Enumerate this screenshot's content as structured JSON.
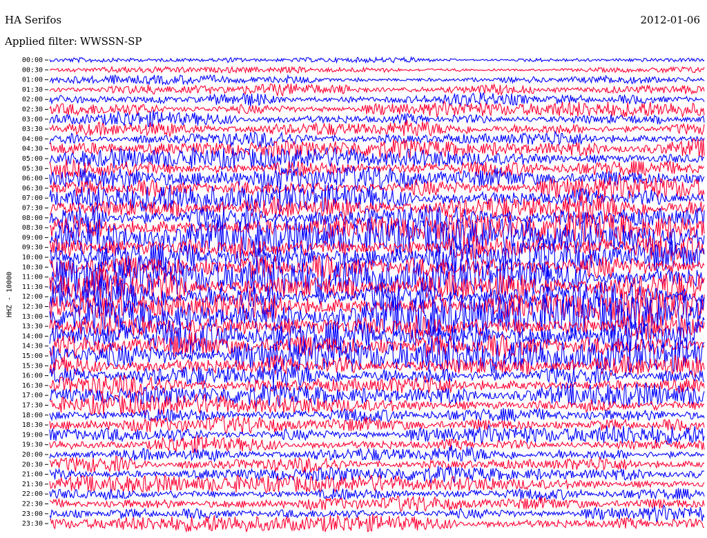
{
  "header": {
    "station": "HA Serifos",
    "date": "2012-01-06",
    "filter_label": "Applied filter:",
    "filter_value": "WWSSN-SP"
  },
  "chart_data": {
    "type": "line",
    "title": "HA Serifos",
    "ylabel": "HHZ - 10000",
    "colors": [
      "#0000ff",
      "#ff0033"
    ],
    "row_labels": [
      "00:00",
      "00:30",
      "01:00",
      "01:30",
      "02:00",
      "02:30",
      "03:00",
      "03:30",
      "04:00",
      "04:30",
      "05:00",
      "05:30",
      "06:00",
      "06:30",
      "07:00",
      "07:30",
      "08:00",
      "08:30",
      "09:00",
      "09:30",
      "10:00",
      "10:30",
      "11:00",
      "11:30",
      "12:00",
      "12:30",
      "13:00",
      "13:30",
      "14:00",
      "14:30",
      "15:00",
      "15:30",
      "16:00",
      "16:30",
      "17:00",
      "17:30",
      "18:00",
      "18:30",
      "19:00",
      "19:30",
      "20:00",
      "20:30",
      "21:00",
      "21:30",
      "22:00",
      "22:30",
      "23:00",
      "23:30"
    ],
    "relative_amplitude": [
      0.25,
      0.3,
      0.45,
      0.6,
      0.7,
      0.75,
      0.8,
      0.85,
      0.9,
      0.95,
      1.0,
      1.1,
      1.2,
      1.3,
      1.4,
      1.5,
      1.6,
      1.7,
      1.7,
      1.8,
      1.9,
      1.9,
      1.9,
      2.0,
      2.0,
      2.0,
      2.0,
      2.0,
      1.9,
      1.8,
      1.7,
      1.5,
      1.3,
      1.2,
      1.1,
      1.0,
      0.95,
      0.9,
      0.9,
      0.85,
      0.85,
      0.85,
      0.8,
      0.8,
      0.8,
      0.8,
      0.8,
      0.85
    ]
  }
}
